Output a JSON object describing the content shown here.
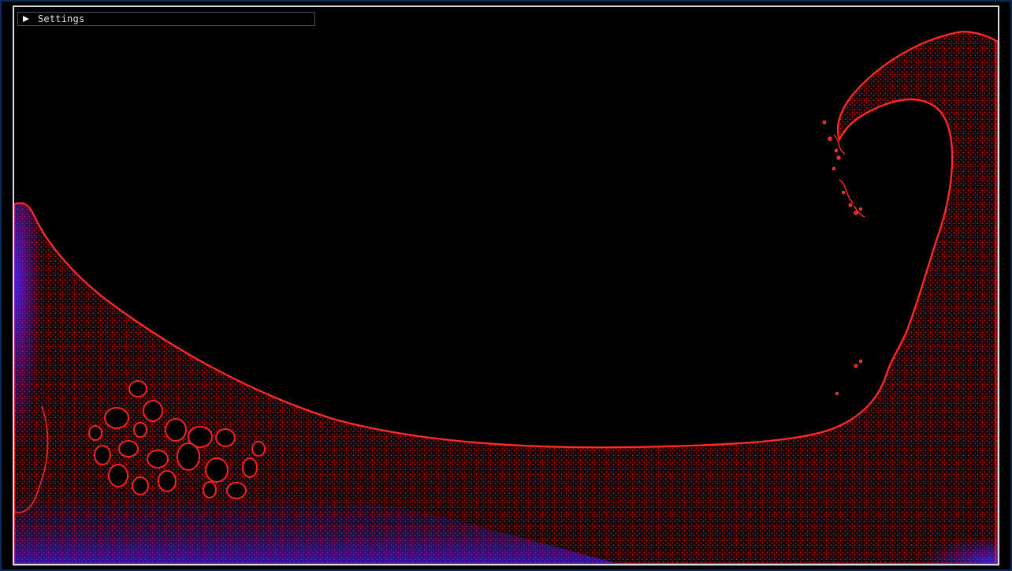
{
  "settings": {
    "label": "Settings",
    "icon": "collapsed-triangle-icon"
  },
  "colors": {
    "background": "#000000",
    "fluid_primary": "#e31010",
    "fluid_deep": "#4e18d9",
    "viewport_border": "#d9dde6",
    "window_edge": "#0b2a57"
  }
}
